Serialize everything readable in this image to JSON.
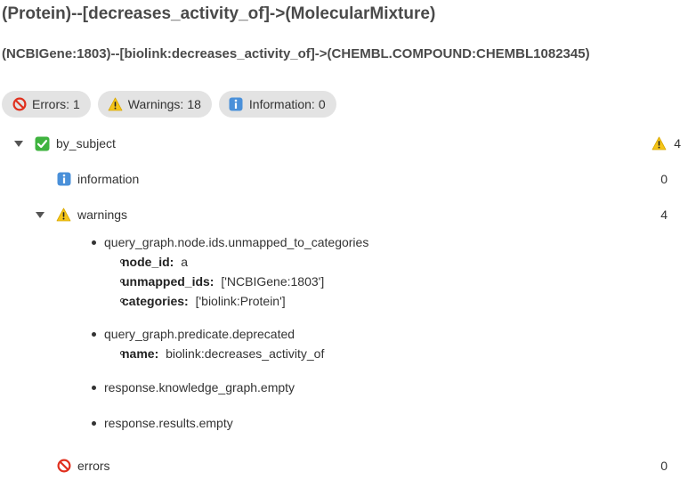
{
  "header": {
    "title": "(Protein)--[decreases_activity_of]->(MolecularMixture)",
    "subtitle": "(NCBIGene:1803)--[biolink:decreases_activity_of]->(CHEMBL.COMPOUND:CHEMBL1082345)"
  },
  "badges": [
    {
      "icon": "prohibited-icon",
      "label": "Errors:",
      "count": "1"
    },
    {
      "icon": "warning-icon",
      "label": "Warnings:",
      "count": "18"
    },
    {
      "icon": "info-icon",
      "label": "Information:",
      "count": "0"
    }
  ],
  "tree": {
    "by_subject": {
      "icon": "check-icon",
      "label": "by_subject",
      "count_icon": "warning-icon",
      "count": "4"
    },
    "information": {
      "icon": "info-icon",
      "label": "information",
      "count": "0"
    },
    "warnings": {
      "icon": "warning-icon",
      "label": "warnings",
      "count": "4",
      "items": [
        {
          "code": "query_graph.node.ids.unmapped_to_categories",
          "details": [
            {
              "key": "node_id:",
              "value": "a"
            },
            {
              "key": "unmapped_ids:",
              "value": "['NCBIGene:1803']"
            },
            {
              "key": "categories:",
              "value": "['biolink:Protein']"
            }
          ]
        },
        {
          "code": "query_graph.predicate.deprecated",
          "details": [
            {
              "key": "name:",
              "value": "biolink:decreases_activity_of"
            }
          ]
        },
        {
          "code": "response.knowledge_graph.empty"
        },
        {
          "code": "response.results.empty"
        }
      ]
    },
    "errors": {
      "icon": "prohibited-icon",
      "label": "errors",
      "count": "0"
    }
  },
  "colors": {
    "badge_bg": "#e3e3e3",
    "check_green": "#3fb33f",
    "warning_yellow": "#f5c518",
    "info_blue": "#4a90d9",
    "prohibited_red": "#e0301e"
  }
}
